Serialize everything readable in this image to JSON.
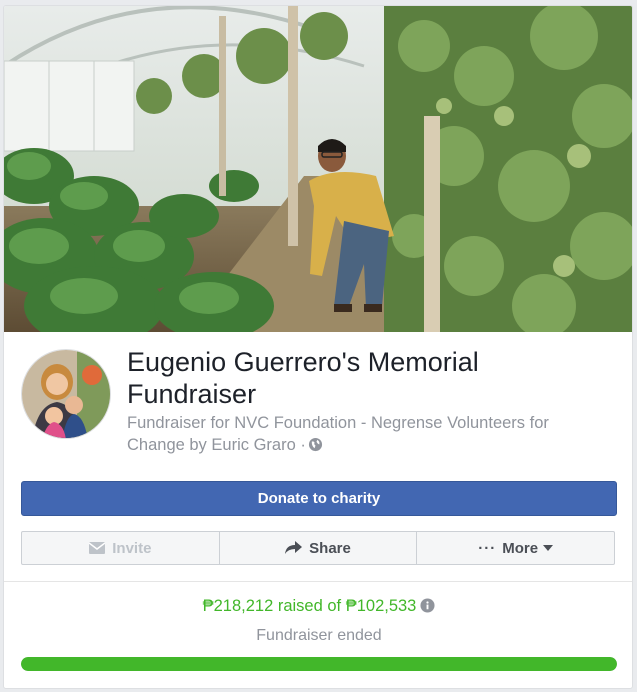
{
  "cover": {
    "alt": "greenhouse-cover-photo"
  },
  "fundraiser": {
    "title": "Eugenio Guerrero's Memorial Fundraiser",
    "subtitle": "Fundraiser for NVC Foundation - Negrense Volunteers for Change by Euric Graro ·",
    "privacy_icon": "globe-icon"
  },
  "actions": {
    "donate_label": "Donate to charity",
    "invite_label": "Invite",
    "invite_icon": "envelope-icon",
    "share_label": "Share",
    "share_icon": "share-arrow-icon",
    "more_label": "More",
    "more_dots": "···",
    "more_icon": "caret-down-icon"
  },
  "progress": {
    "raised_text": "₱218,212 raised of ₱102,533",
    "info_icon": "info-icon",
    "status": "Fundraiser ended",
    "fill_fraction": 1.0
  },
  "colors": {
    "primary": "#4267b2",
    "success": "#42b72a",
    "muted": "#90949c",
    "text": "#1d2129"
  }
}
